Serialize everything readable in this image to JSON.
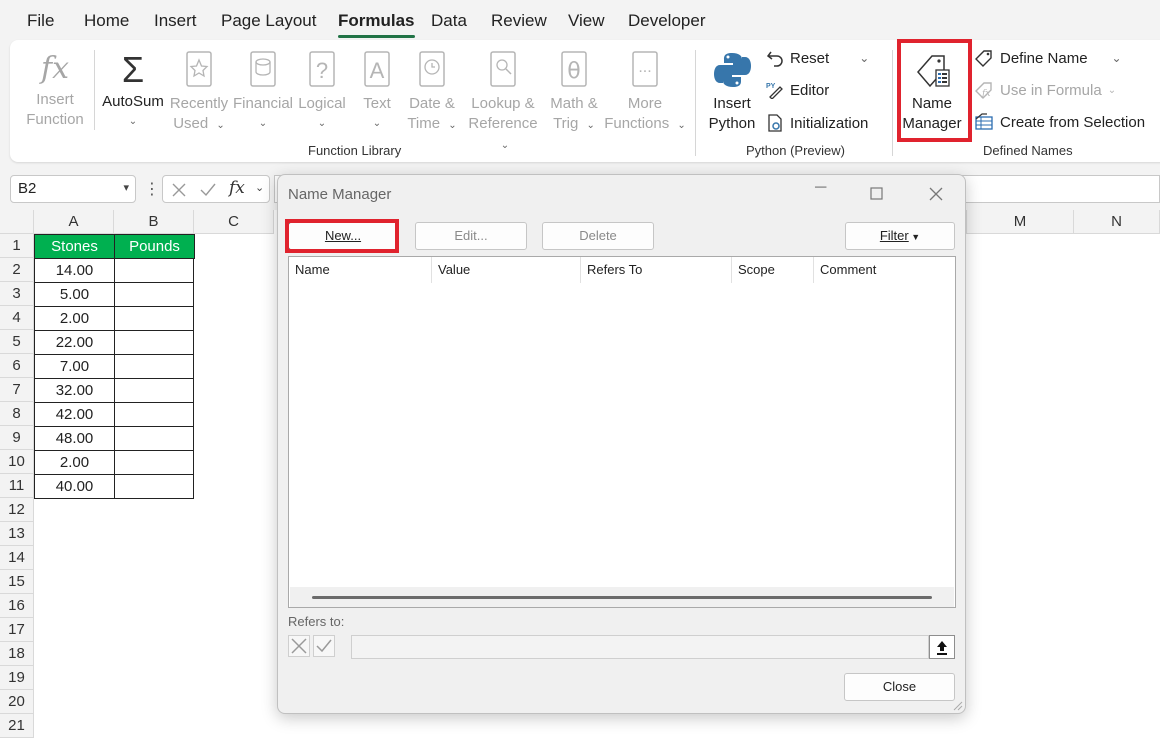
{
  "menu": {
    "tabs": [
      "File",
      "Home",
      "Insert",
      "Page Layout",
      "Formulas",
      "Data",
      "Review",
      "View",
      "Developer"
    ],
    "active": "Formulas"
  },
  "ribbon": {
    "function_library": {
      "insert_function": [
        "Insert",
        "Function"
      ],
      "autosum": "AutoSum",
      "recently_used": [
        "Recently",
        "Used"
      ],
      "financial": "Financial",
      "logical": "Logical",
      "text": "Text",
      "date_time": [
        "Date &",
        "Time"
      ],
      "lookup_reference": [
        "Lookup &",
        "Reference"
      ],
      "math_trig": [
        "Math &",
        "Trig"
      ],
      "more_functions": [
        "More",
        "Functions"
      ],
      "label": "Function Library"
    },
    "python": {
      "insert_python": [
        "Insert",
        "Python"
      ],
      "reset": "Reset",
      "editor": "Editor",
      "initialization": "Initialization",
      "label": "Python (Preview)"
    },
    "defined_names": {
      "name_manager": [
        "Name",
        "Manager"
      ],
      "define_name": "Define Name",
      "use_in_formula": "Use in Formula",
      "create_from_selection": "Create from Selection",
      "label": "Defined Names"
    }
  },
  "formula_bar": {
    "name_box": "B2",
    "fx": "fx",
    "content": ""
  },
  "sheet": {
    "columns": [
      "A",
      "B",
      "C",
      "M",
      "N"
    ],
    "rows": [
      "1",
      "2",
      "3",
      "4",
      "5",
      "6",
      "7",
      "8",
      "9",
      "10",
      "11",
      "12",
      "13",
      "14",
      "15",
      "16",
      "17",
      "18",
      "19",
      "20",
      "21"
    ],
    "header": [
      "Stones",
      "Pounds"
    ],
    "stones": [
      "14.00",
      "5.00",
      "2.00",
      "22.00",
      "7.00",
      "32.00",
      "42.00",
      "48.00",
      "2.00",
      "40.00"
    ]
  },
  "dialog": {
    "title": "Name Manager",
    "buttons": {
      "new": "New...",
      "edit": "Edit...",
      "delete": "Delete",
      "filter": "Filter",
      "close": "Close"
    },
    "columns": [
      "Name",
      "Value",
      "Refers To",
      "Scope",
      "Comment"
    ],
    "refers_to_label": "Refers to:",
    "refers_to_value": ""
  },
  "colors": {
    "accent_green": "#217346",
    "header_fill": "#00b050",
    "highlight_red": "#e0232e"
  }
}
